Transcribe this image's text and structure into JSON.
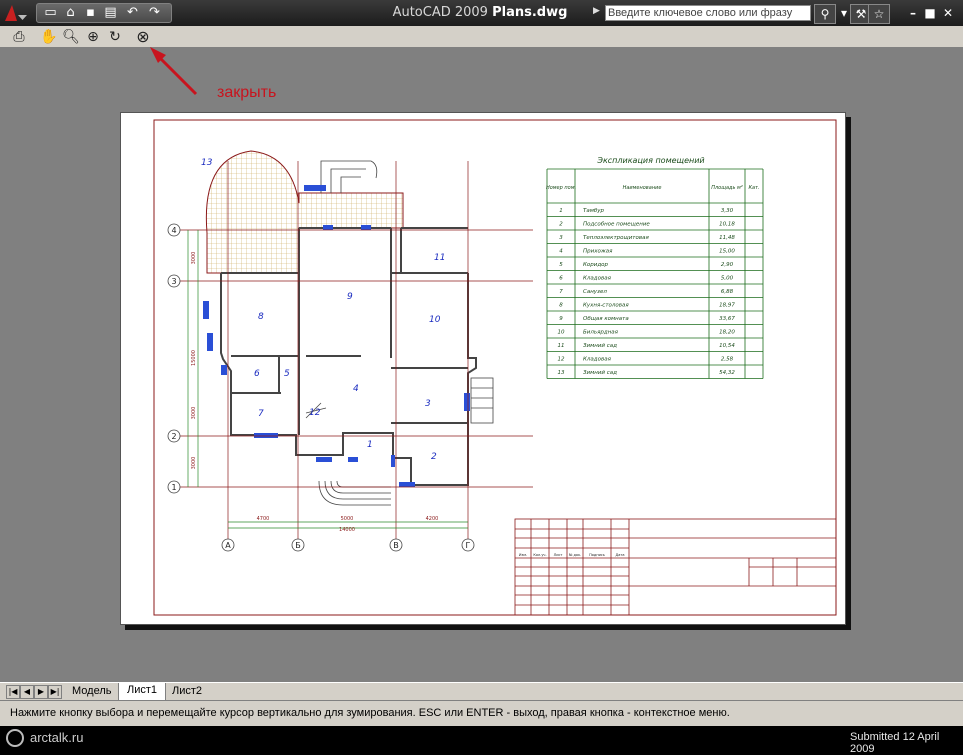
{
  "window": {
    "app_name": "AutoCAD 2009",
    "file_name": "Plans.dwg",
    "search_placeholder": "Введите ключевое слово или фразу"
  },
  "annotation": {
    "text": "закрыть",
    "color": "#c8141e"
  },
  "drawing": {
    "table_title": "Экспликация помещений",
    "table_headers": [
      "Номер пом.",
      "Наименование",
      "Площадь м²",
      "Кат."
    ],
    "rooms": [
      {
        "num": "1",
        "name": "Тамбур",
        "area": "3,30"
      },
      {
        "num": "2",
        "name": "Подсобное помещение",
        "area": "10,18"
      },
      {
        "num": "3",
        "name": "Теплоэлектрощитовая",
        "area": "11,48"
      },
      {
        "num": "4",
        "name": "Прихожая",
        "area": "15,00"
      },
      {
        "num": "5",
        "name": "Коридор",
        "area": "2,90"
      },
      {
        "num": "6",
        "name": "Кладовая",
        "area": "5,00"
      },
      {
        "num": "7",
        "name": "Санузел",
        "area": "6,88"
      },
      {
        "num": "8",
        "name": "Кухня-столовая",
        "area": "18,97"
      },
      {
        "num": "9",
        "name": "Общая комната",
        "area": "33,67"
      },
      {
        "num": "10",
        "name": "Бильярдная",
        "area": "18,20"
      },
      {
        "num": "11",
        "name": "Зимний сад",
        "area": "10,54"
      },
      {
        "num": "12",
        "name": "Кладовая",
        "area": "2,58"
      },
      {
        "num": "13",
        "name": "Зимний сад",
        "area": "54,32"
      }
    ],
    "room_labels": [
      "1",
      "2",
      "3",
      "4",
      "5",
      "6",
      "7",
      "8",
      "9",
      "10",
      "11",
      "12",
      "13"
    ],
    "axes_letters": [
      "А",
      "Б",
      "В",
      "Г"
    ],
    "axes_numbers": [
      "1",
      "2",
      "3",
      "4"
    ],
    "dims_bottom": [
      "4700",
      "5000",
      "4200"
    ],
    "dim_total": "14000",
    "dims_left": [
      "3000",
      "15000",
      "3000",
      "3000"
    ],
    "stamp_headers": [
      "Изм.",
      "Кол.уч.",
      "Лист",
      "№ док.",
      "Подпись",
      "Дата"
    ]
  },
  "tabs": {
    "model": "Модель",
    "sheet1": "Лист1",
    "sheet2": "Лист2"
  },
  "status": {
    "message": "Нажмите кнопку выбора и перемещайте курсор вертикально для зумирования. ESC или ENTER - выход, правая кнопка - контекстное меню."
  },
  "footer": {
    "watermark": "arctalk.ru",
    "submitted": "Submitted 12 April 2009"
  },
  "colors": {
    "drawing_line": "#8b1a1a",
    "room_number": "#1c2dc0",
    "table_line": "#1a6b1a",
    "hatch": "#d8c27a"
  }
}
